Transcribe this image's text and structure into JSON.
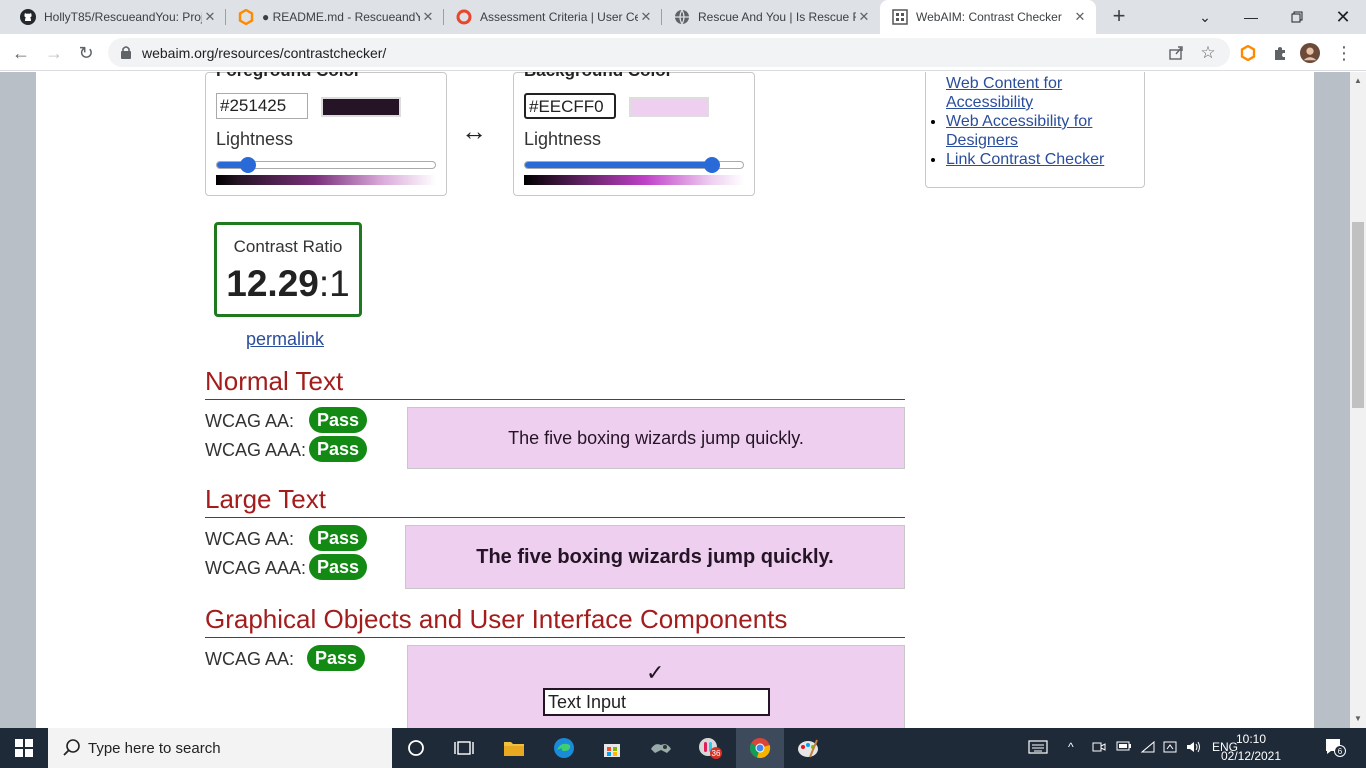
{
  "browser": {
    "tabs": [
      {
        "title": "HollyT85/RescueandYou: Proj",
        "icon": "github-icon"
      },
      {
        "title": "● README.md - RescueandYo",
        "icon": "gitpod-icon"
      },
      {
        "title": "Assessment Criteria | User Ce",
        "icon": "code-institute-icon"
      },
      {
        "title": "Rescue And You | Is Rescue R",
        "icon": "globe-icon"
      },
      {
        "title": "WebAIM: Contrast Checker",
        "icon": "webaim-icon",
        "active": true
      }
    ],
    "url": "webaim.org/resources/contrastchecker/"
  },
  "checker": {
    "foreground": {
      "heading": "Foreground Color",
      "hex": "#251425",
      "swatch": "#251425",
      "lightness_label": "Lightness",
      "lightness_value": 0.14
    },
    "background": {
      "heading": "Background Color",
      "hex": "#EECFF0",
      "swatch": "#eecff0",
      "lightness_label": "Lightness",
      "lightness_value": 0.86
    },
    "swap_symbol": "↔",
    "ratio_label": "Contrast Ratio",
    "ratio_value": "12.29",
    "ratio_suffix": ":1",
    "permalink": "permalink"
  },
  "sidebar_links": [
    "Web Content for Accessibility",
    "Web Accessibility for Designers",
    "Link Contrast Checker"
  ],
  "sections": {
    "normal": {
      "heading": "Normal Text",
      "aa_label": "WCAG AA:",
      "aa_result": "Pass",
      "aaa_label": "WCAG AAA:",
      "aaa_result": "Pass",
      "sample": "The five boxing wizards jump quickly."
    },
    "large": {
      "heading": "Large Text",
      "aa_label": "WCAG AA:",
      "aa_result": "Pass",
      "aaa_label": "WCAG AAA:",
      "aaa_result": "Pass",
      "sample": "The five boxing wizards jump quickly."
    },
    "graphical": {
      "heading": "Graphical Objects and User Interface Components",
      "aa_label": "WCAG AA:",
      "aa_result": "Pass",
      "check": "✓",
      "input_value": "Text Input"
    }
  },
  "taskbar": {
    "search_placeholder": "Type here to search",
    "badge_count": "36",
    "language": "ENG",
    "time": "10:10",
    "date": "02/12/2021",
    "notifications": "6"
  }
}
